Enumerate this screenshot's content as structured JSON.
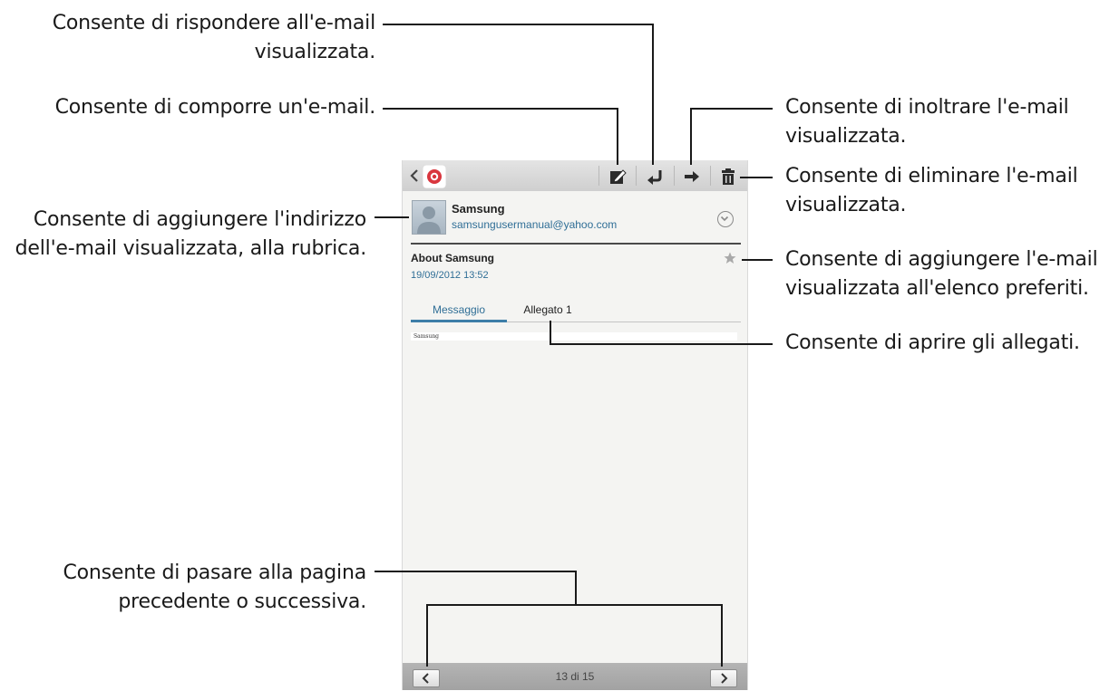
{
  "callouts": {
    "reply": "Consente di rispondere all'e-mail\nvisualizzata.",
    "compose": "Consente di comporre un'e-mail.",
    "forward": "Consente di inoltrare l'e-mail\nvisualizzata.",
    "delete": "Consente di eliminare l'e-mail\nvisualizzata.",
    "add_contact": "Consente di aggiungere l'indirizzo\ndell'e-mail visualizzata, alla rubrica.",
    "favourite": "Consente di aggiungere l'e-mail\nvisualizzata all'elenco preferiti.",
    "attachments": "Consente di aprire gli allegati.",
    "paging": "Consente di pasare alla pagina\nprecedente o successiva."
  },
  "email": {
    "sender_name": "Samsung",
    "sender_address": "samsungusermanual@yahoo.com",
    "subject": "About Samsung",
    "date": "19/09/2012  13:52",
    "body_preview": "Samsung"
  },
  "tabs": {
    "message": "Messaggio",
    "attachment": "Allegato 1"
  },
  "pager": {
    "count": "13 di 15"
  },
  "icons": [
    "back-chevron-icon",
    "email-app-icon",
    "compose-icon",
    "reply-icon",
    "forward-icon",
    "delete-icon",
    "expand-circle-icon",
    "star-icon",
    "prev-icon",
    "next-icon"
  ],
  "colors": {
    "accent": "#2f6e96",
    "tab_indicator": "#3d7ea8",
    "leader_line": "#1a1a1a",
    "app_icon_red": "#d9363e"
  }
}
